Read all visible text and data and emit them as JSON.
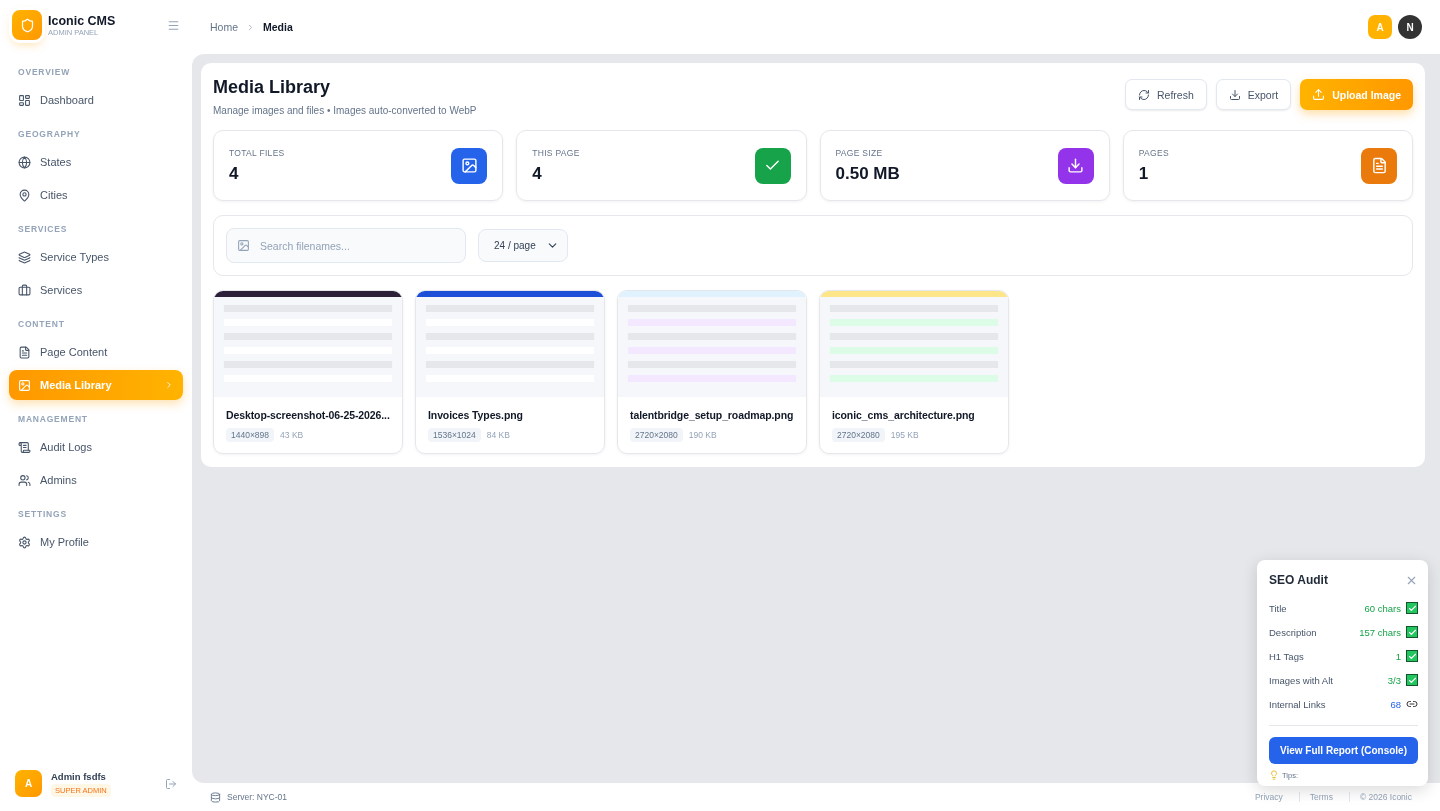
{
  "brand": {
    "name": "Iconic CMS",
    "subtitle": "ADMIN PANEL"
  },
  "sidebar": {
    "sections": [
      {
        "title": "OVERVIEW",
        "items": [
          {
            "label": "Dashboard",
            "selected": false
          }
        ]
      },
      {
        "title": "GEOGRAPHY",
        "items": [
          {
            "label": "States",
            "selected": false
          },
          {
            "label": "Cities",
            "selected": false
          }
        ]
      },
      {
        "title": "SERVICES",
        "items": [
          {
            "label": "Service Types",
            "selected": false
          },
          {
            "label": "Services",
            "selected": false
          }
        ]
      },
      {
        "title": "CONTENT",
        "items": [
          {
            "label": "Page Content",
            "selected": false
          },
          {
            "label": "Media Library",
            "selected": true
          }
        ]
      },
      {
        "title": "MANAGEMENT",
        "items": [
          {
            "label": "Audit Logs",
            "selected": false
          },
          {
            "label": "Admins",
            "selected": false
          }
        ]
      },
      {
        "title": "SETTINGS",
        "items": [
          {
            "label": "My Profile",
            "selected": false
          }
        ]
      }
    ]
  },
  "user": {
    "initial": "A",
    "name": "Admin fsdfs",
    "role": "SUPER ADMIN"
  },
  "breadcrumb": [
    {
      "label": "Home",
      "selected": false
    },
    {
      "label": "Media",
      "selected": true
    }
  ],
  "header_avatars": [
    "A",
    "N"
  ],
  "page": {
    "title": "Media Library",
    "subtitle": "Manage images and files • Images auto-converted to WebP",
    "actions": [
      {
        "label": "Refresh",
        "kind": "secondary"
      },
      {
        "label": "Export",
        "kind": "secondary"
      },
      {
        "label": "Upload Image",
        "kind": "primary"
      }
    ]
  },
  "stats": [
    {
      "label": "TOTAL FILES",
      "value": "4",
      "color": "#2563eb"
    },
    {
      "label": "THIS PAGE",
      "value": "4",
      "color": "#16a34a"
    },
    {
      "label": "PAGE SIZE",
      "value": "0.50 MB",
      "color": "#9333ea"
    },
    {
      "label": "PAGES",
      "value": "1",
      "color": "#ea7a0c"
    }
  ],
  "filters": {
    "search": {
      "placeholder": "Search filenames..."
    },
    "page_size": "24 / page"
  },
  "media": [
    {
      "name": "Desktop-screenshot-06-25-2026...",
      "dimensions": "1440×898",
      "size": "43 KB"
    },
    {
      "name": "Invoices Types.png",
      "dimensions": "1536×1024",
      "size": "84 KB"
    },
    {
      "name": "talentbridge_setup_roadmap.png",
      "dimensions": "2720×2080",
      "size": "190 KB"
    },
    {
      "name": "iconic_cms_architecture.png",
      "dimensions": "2720×2080",
      "size": "195 KB"
    }
  ],
  "footer": {
    "server": "Server: NYC-01",
    "links": [
      "Privacy",
      "Terms",
      "© 2026 Iconic"
    ]
  },
  "seo_audit": {
    "title": "SEO Audit",
    "rows": [
      {
        "label": "Title",
        "value": "60 chars",
        "kind": "check",
        "checked": true
      },
      {
        "label": "Description",
        "value": "157 chars",
        "kind": "check",
        "checked": true
      },
      {
        "label": "H1 Tags",
        "value": "1",
        "kind": "check",
        "checked": true
      },
      {
        "label": "Images with Alt",
        "value": "3/3",
        "kind": "check",
        "checked": true
      },
      {
        "label": "Internal Links",
        "value": "68",
        "kind": "link"
      }
    ],
    "button": "View Full Report (Console)",
    "tips": "Tips:"
  }
}
